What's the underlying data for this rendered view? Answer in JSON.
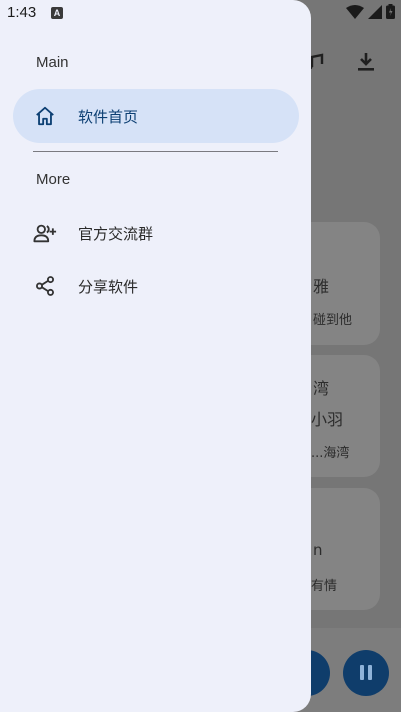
{
  "status_bar": {
    "time": "1:43",
    "app_icon_glyph": "A"
  },
  "drawer": {
    "sections": [
      {
        "title": "Main",
        "items": [
          {
            "label": "软件首页",
            "icon": "home-icon",
            "active": true
          }
        ]
      },
      {
        "title": "More",
        "items": [
          {
            "label": "官方交流群",
            "icon": "group-add-icon",
            "active": false
          },
          {
            "label": "分享软件",
            "icon": "share-icon",
            "active": false
          }
        ]
      }
    ]
  },
  "background_app": {
    "cards": [
      {
        "title": "雅",
        "subtitle": "碰到他"
      },
      {
        "title": "湾",
        "subtitle": "小羽",
        "detail": "...海湾"
      },
      {
        "title": "n",
        "subtitle": "有情"
      }
    ]
  },
  "colors": {
    "drawer_bg": "#eef0fa",
    "active_item_bg": "#d6e2f7",
    "active_accent": "#0c3f73",
    "scrim": "#767676",
    "fab": "#0f3d6b"
  }
}
